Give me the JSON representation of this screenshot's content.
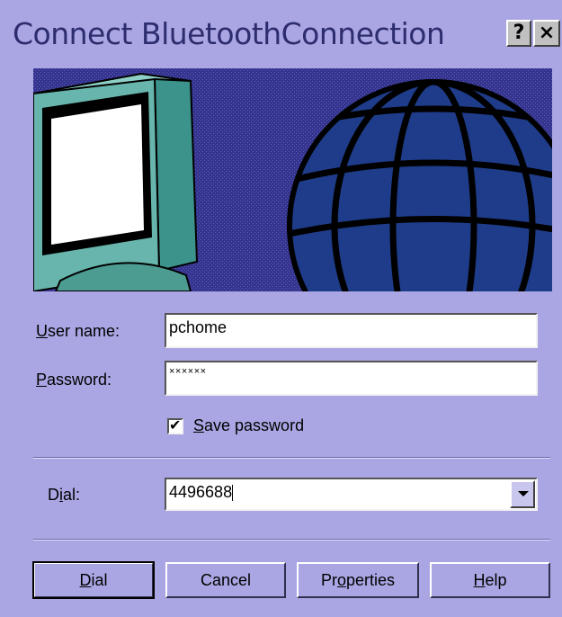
{
  "window": {
    "title": "Connect BluetoothConnection",
    "help_label": "?",
    "close_label": "×"
  },
  "form": {
    "username_label": {
      "first": "U",
      "rest": "ser name:"
    },
    "username_value": "pchome",
    "password_label": {
      "first": "P",
      "rest": "assword:"
    },
    "password_value": "××××××",
    "save_password": {
      "checked": true,
      "check_mark": "✔",
      "label_first": "S",
      "label_rest": "ave password"
    },
    "dial_label": {
      "before": "D",
      "underlined": "i",
      "after": "al:"
    },
    "dial_value": "4496688"
  },
  "buttons": {
    "dial": {
      "first": "D",
      "rest": "ial"
    },
    "cancel": "Cancel",
    "properties": {
      "before": "Pr",
      "underlined": "o",
      "after": "perties"
    },
    "help": {
      "first": "H",
      "rest": "elp"
    }
  },
  "icons": {
    "banner_monitor": "monitor-icon",
    "banner_globe": "globe-icon",
    "combo_arrow": "chevron-down-icon",
    "check": "check-icon"
  }
}
